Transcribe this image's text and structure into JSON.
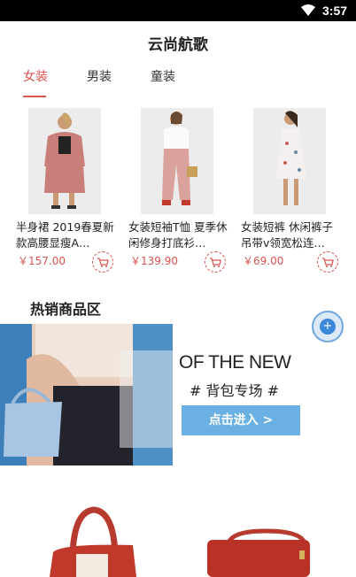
{
  "status": {
    "time": "3:57"
  },
  "app": {
    "title": "云尚航歌"
  },
  "tabs": [
    {
      "label": "女装",
      "active": true
    },
    {
      "label": "男装",
      "active": false
    },
    {
      "label": "童装",
      "active": false
    }
  ],
  "products": [
    {
      "title": "半身裙 2019春夏新款高腰显瘦A…",
      "price": "￥157.00"
    },
    {
      "title": "女装短袖T恤 夏季休闲修身打底衫…",
      "price": "￥139.90"
    },
    {
      "title": "女装短裤 休闲裤子吊带v领宽松连…",
      "price": "￥69.00"
    }
  ],
  "hot_section": {
    "title": "热销商品区"
  },
  "banner": {
    "heading": "OF THE NEW",
    "subheading": "# 背包专场 #",
    "cta": "点击进入 >"
  },
  "colors": {
    "accent": "#d9534f",
    "banner_button": "#6ab0e3",
    "float_button": "#3b88d8"
  },
  "icons": [
    "wifi-icon",
    "cart-icon",
    "float-action-icon"
  ]
}
